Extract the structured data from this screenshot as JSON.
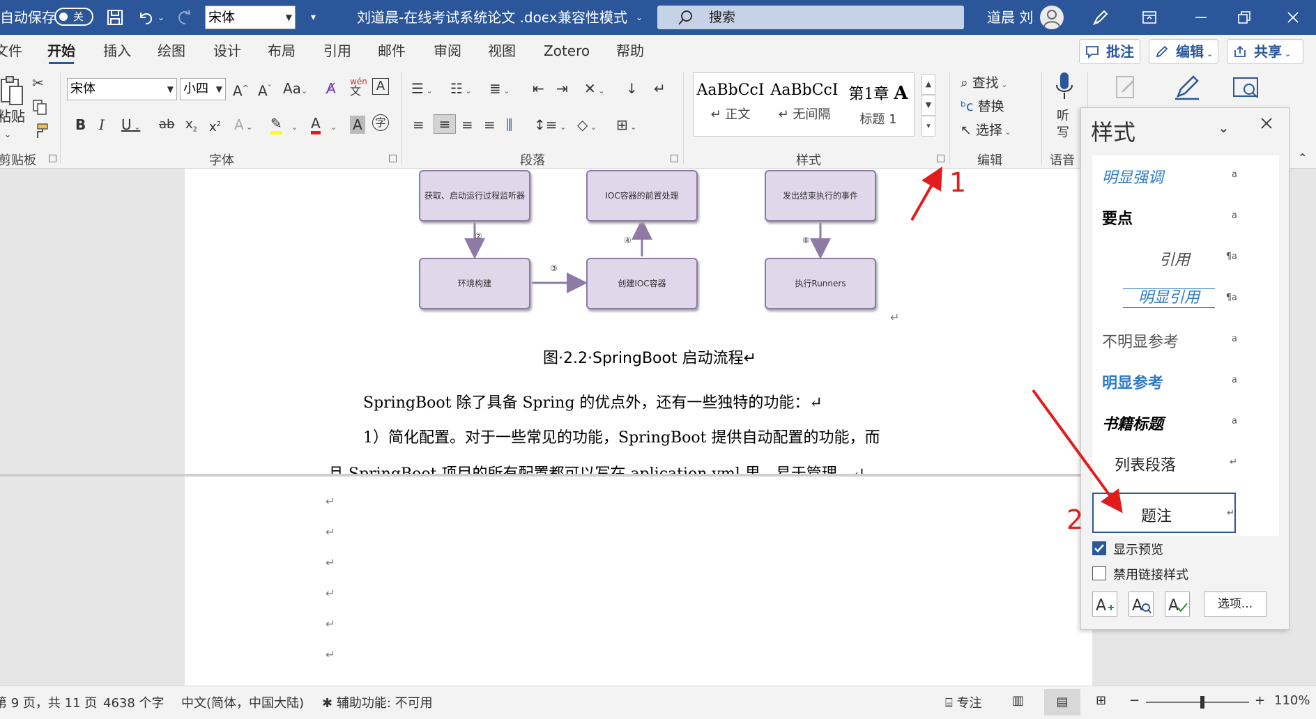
{
  "titlebar": {
    "autosave_label": "自动保存",
    "autosave_state": "关",
    "font_name": "宋体",
    "doc_title": "刘道晨-在线考试系统论文 .docx",
    "separator": "-",
    "mode": "兼容性模式",
    "search_placeholder": "搜索",
    "user_name": "道晨 刘"
  },
  "tabs": [
    "文件",
    "开始",
    "插入",
    "绘图",
    "设计",
    "布局",
    "引用",
    "邮件",
    "审阅",
    "视图",
    "Zotero",
    "帮助"
  ],
  "top_buttons": {
    "comment": "批注",
    "edit": "编辑",
    "share": "共享"
  },
  "ribbon": {
    "clipboard": {
      "paste": "粘贴",
      "group": "剪贴板"
    },
    "font": {
      "name": "宋体",
      "size": "小四",
      "group": "字体",
      "case": "Aa"
    },
    "paragraph": {
      "group": "段落"
    },
    "styles": {
      "group": "样式",
      "gallery": [
        {
          "preview": "AaBbCcI",
          "name": "↵ 正文"
        },
        {
          "preview": "AaBbCcI",
          "name": "↵ 无间隔"
        },
        {
          "preview": "第1章",
          "name": "标题 1"
        }
      ]
    },
    "editing": {
      "find": "查找",
      "replace": "替换",
      "select": "选择",
      "group": "编辑"
    },
    "voice": {
      "dictate_1": "听",
      "dictate_2": "写",
      "group": "语音"
    }
  },
  "document": {
    "flow": {
      "nodes": [
        "获取、启动运行过程监听器",
        "IOC容器的前置处理",
        "发出结束执行的事件",
        "环境构建",
        "创建IOC容器",
        "执行Runners"
      ],
      "steps": [
        "②",
        "③",
        "④",
        "⑧"
      ]
    },
    "caption": "图·2.2·SpringBoot 启动流程↵",
    "para1": "SpringBoot 除了具备 Spring 的优点外，还有一些独特的功能：↵",
    "para2": "1）简化配置。对于一些常见的功能，SpringBoot 提供自动配置的功能，而",
    "para3": "且 SpringBoot 项目的所有配置都可以写在 aplication.yml 里，易于管理。↵",
    "return_mark": "↵"
  },
  "styles_pane": {
    "title": "样式",
    "items": [
      {
        "name": "明显强调",
        "mark": "a"
      },
      {
        "name": "要点",
        "mark": "a"
      },
      {
        "name": "引用",
        "mark": "¶a"
      },
      {
        "name": "明显引用",
        "mark": "¶a"
      },
      {
        "name": "不明显参考",
        "mark": "a"
      },
      {
        "name": "明显参考",
        "mark": "a"
      },
      {
        "name": "书籍标题",
        "mark": "a"
      },
      {
        "name": "列表段落",
        "mark": "↵"
      },
      {
        "name": "题注",
        "mark": "↵"
      }
    ],
    "show_preview": "显示预览",
    "show_preview_checked": true,
    "disable_linked": "禁用链接样式",
    "disable_linked_checked": false,
    "options_button": "选项..."
  },
  "annotations": {
    "marker1": "1",
    "marker2": "2"
  },
  "statusbar": {
    "page": "第 9 页，共 11 页",
    "words": "4638 个字",
    "language": "中文(简体，中国大陆)",
    "accessibility": "辅助功能: 不可用",
    "focus": "专注",
    "zoom": "110%",
    "zoom_level_fraction": 0.55
  },
  "colors": {
    "accent": "#2b579a",
    "annotation": "#e21c1c",
    "node_fill": "#e1d7ea",
    "node_border": "#8f7aa6"
  }
}
